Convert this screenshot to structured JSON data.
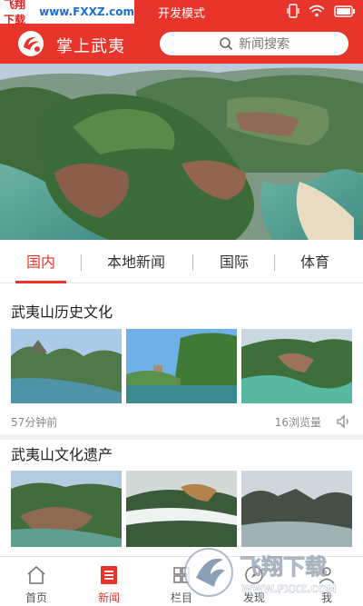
{
  "status_bar": {
    "watermark_text": "飞翔下载",
    "watermark_url": "www.FXXZ.com",
    "mode_label": "开发模式"
  },
  "header": {
    "app_title": "掌上武夷",
    "search_placeholder": "新闻搜索"
  },
  "tabs": [
    {
      "label": "国内",
      "active": true
    },
    {
      "label": "本地新闻",
      "active": false
    },
    {
      "label": "国际",
      "active": false
    },
    {
      "label": "体育",
      "active": false
    }
  ],
  "news": [
    {
      "title": "武夷山历史文化",
      "time": "57分钟前",
      "views": "16浏览量"
    },
    {
      "title": "武夷山文化遗产"
    }
  ],
  "bottom_nav": [
    {
      "label": "首页",
      "icon": "home-icon",
      "active": false
    },
    {
      "label": "新闻",
      "icon": "news-icon",
      "active": true
    },
    {
      "label": "栏目",
      "icon": "grid-icon",
      "active": false
    },
    {
      "label": "发现",
      "icon": "discover-icon",
      "active": false
    },
    {
      "label": "我",
      "icon": "user-icon",
      "active": false
    }
  ],
  "watermark": {
    "brand": "飞翔下载",
    "url": "WWW.FXXZ.COM"
  },
  "colors": {
    "accent": "#e8352b"
  }
}
